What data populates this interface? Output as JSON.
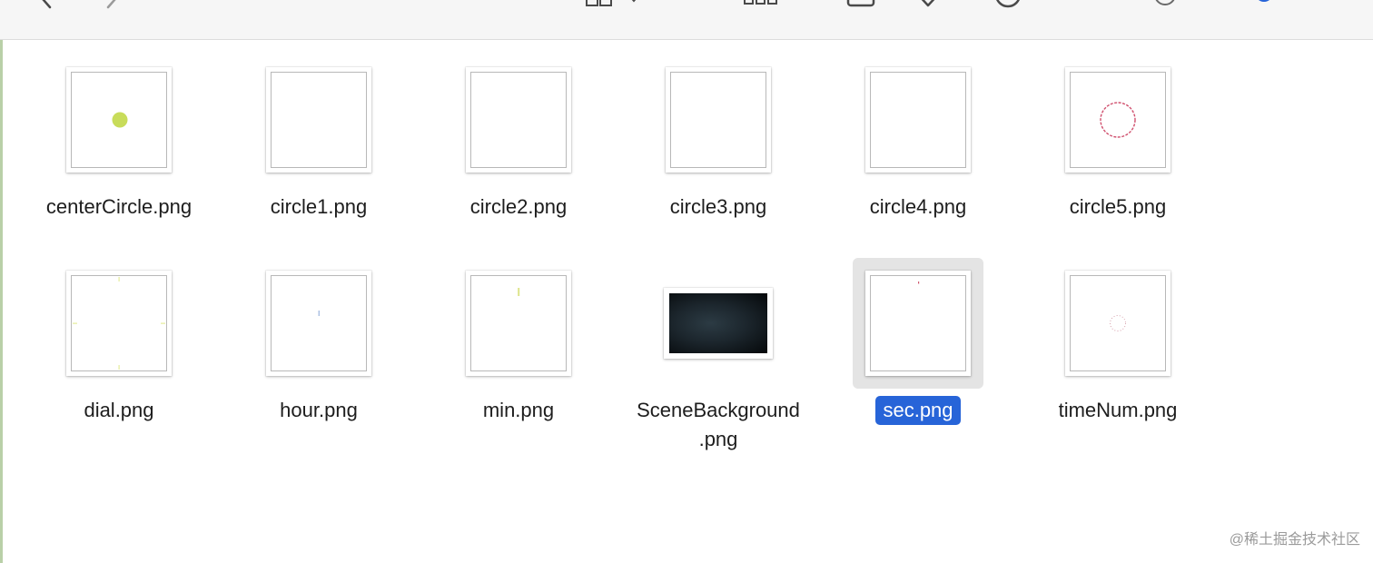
{
  "toolbar": {
    "icons": [
      "back-icon",
      "forward-icon",
      "icon-view-grid-icon",
      "group-by-icon",
      "share-icon",
      "tag-icon",
      "more-actions-icon",
      "search-icon"
    ]
  },
  "files": [
    {
      "name": "centerCircle.png",
      "preview": "center-dot",
      "selected": false
    },
    {
      "name": "circle1.png",
      "preview": "blank",
      "selected": false
    },
    {
      "name": "circle2.png",
      "preview": "blank",
      "selected": false
    },
    {
      "name": "circle3.png",
      "preview": "blank",
      "selected": false
    },
    {
      "name": "circle4.png",
      "preview": "blank",
      "selected": false
    },
    {
      "name": "circle5.png",
      "preview": "red-ring",
      "selected": false
    },
    {
      "name": "dial.png",
      "preview": "dial-ticks",
      "selected": false
    },
    {
      "name": "hour.png",
      "preview": "hour-hand",
      "selected": false
    },
    {
      "name": "min.png",
      "preview": "minute-hand",
      "selected": false
    },
    {
      "name": "SceneBackground",
      "name_line2": ".png",
      "preview": "dark-scene",
      "selected": false
    },
    {
      "name": "sec.png",
      "preview": "second-dot",
      "selected": true
    },
    {
      "name": "timeNum.png",
      "preview": "dotted-ring",
      "selected": false
    }
  ],
  "watermark": "@稀土掘金技术社区",
  "colors": {
    "selection": "#2764d8",
    "selected_tile": "#e4e4e4",
    "center_dot": "#c8dc5a",
    "ring": "#d0506e"
  }
}
